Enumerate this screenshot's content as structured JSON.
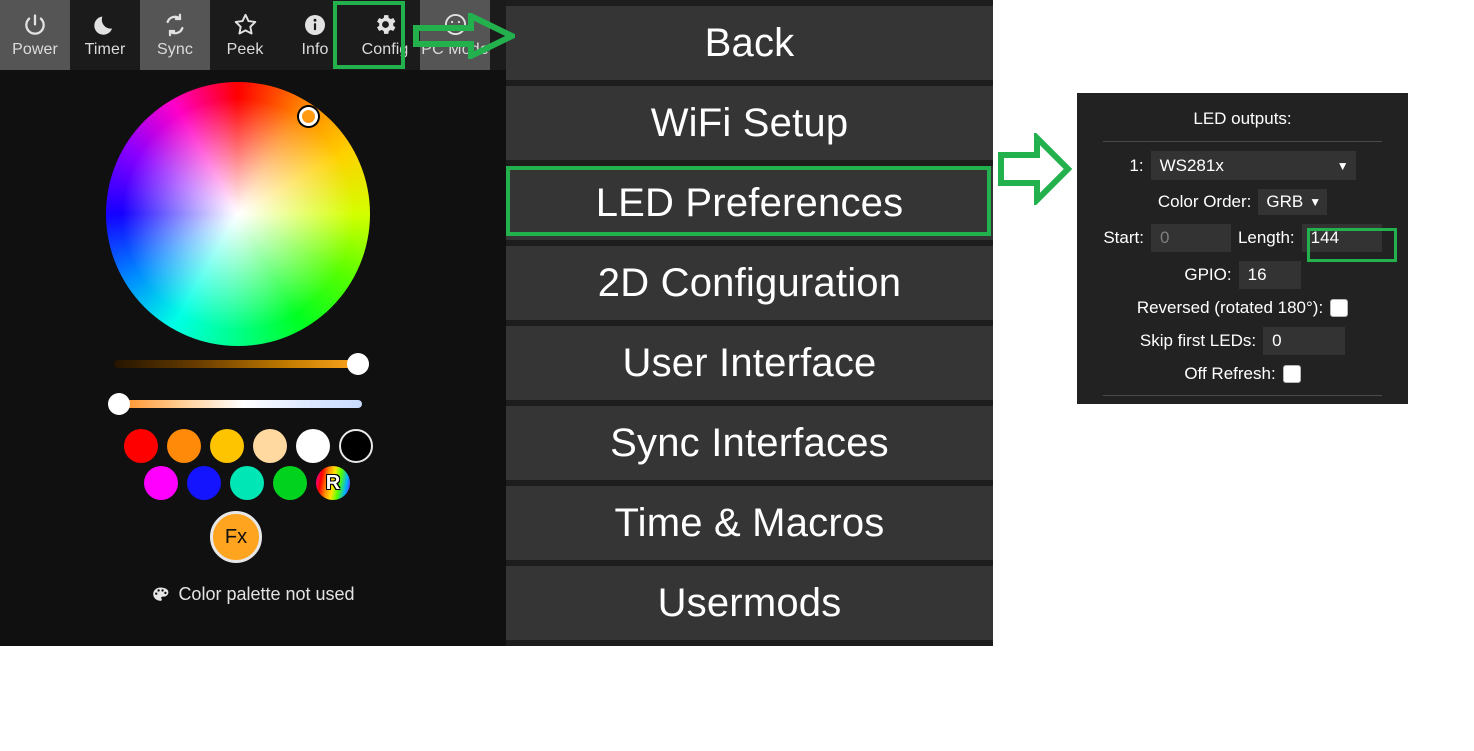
{
  "toolbar": {
    "buttons": [
      {
        "label": "Power",
        "icon": "power-icon",
        "active": true
      },
      {
        "label": "Timer",
        "icon": "moon-icon",
        "active": false
      },
      {
        "label": "Sync",
        "icon": "sync-icon",
        "active": true
      },
      {
        "label": "Peek",
        "icon": "star-icon",
        "active": false
      },
      {
        "label": "Info",
        "icon": "info-icon",
        "active": false
      },
      {
        "label": "Config",
        "icon": "gear-icon",
        "active": false
      },
      {
        "label": "PC Mode",
        "icon": "smiley-icon",
        "active": true
      }
    ]
  },
  "colorpicker": {
    "marker_color": "#ff9a12",
    "sliders": [
      {
        "name": "brightness",
        "value_pct": 94
      },
      {
        "name": "color-temperature",
        "value_pct": 0
      }
    ],
    "swatches_row1": [
      "#ff0000",
      "#ff8a0a",
      "#ffc400",
      "#ffd9a0",
      "#ffffff",
      "#000000"
    ],
    "swatches_row2": [
      "#ff00ff",
      "#1414ff",
      "#00e6b4",
      "#00d21e",
      "random"
    ],
    "random_label": "R",
    "fx_label": "Fx",
    "palette_text": "Color palette not used",
    "palette_icon": "palette-icon"
  },
  "menu": {
    "items": [
      {
        "label": "Back",
        "highlighted": false
      },
      {
        "label": "WiFi Setup",
        "highlighted": false
      },
      {
        "label": "LED Preferences",
        "highlighted": true
      },
      {
        "label": "2D Configuration",
        "highlighted": false
      },
      {
        "label": "User Interface",
        "highlighted": false
      },
      {
        "label": "Sync Interfaces",
        "highlighted": false
      },
      {
        "label": "Time & Macros",
        "highlighted": false
      },
      {
        "label": "Usermods",
        "highlighted": false
      }
    ]
  },
  "led_panel": {
    "title": "LED outputs:",
    "output_index": "1:",
    "led_type": "WS281x",
    "color_order_label": "Color Order:",
    "color_order": "GRB",
    "start_label": "Start:",
    "start_value": "0",
    "length_label": "Length:",
    "length_value": "144",
    "gpio_label": "GPIO:",
    "gpio_value": "16",
    "reversed_label": "Reversed (rotated 180°):",
    "skip_label": "Skip first LEDs:",
    "skip_value": "0",
    "off_refresh_label": "Off Refresh:"
  },
  "annotations": {
    "highlight_color": "#22b14c",
    "arrows": [
      {
        "name": "arrow-pc-mode",
        "direction": "right"
      },
      {
        "name": "arrow-to-led-panel",
        "direction": "right"
      }
    ]
  }
}
